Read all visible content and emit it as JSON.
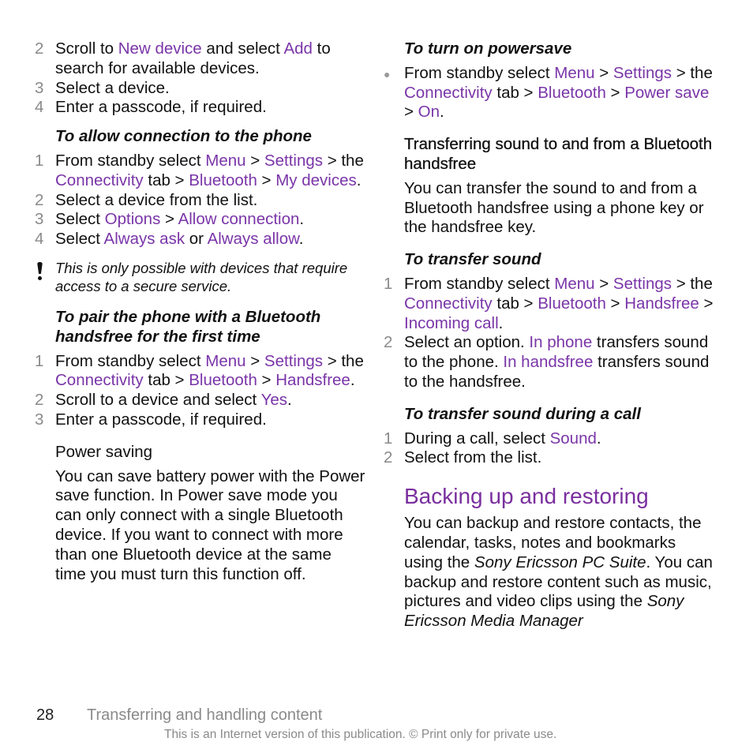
{
  "left": {
    "steps_a": [
      {
        "num": "2",
        "parts": [
          "Scroll to ",
          "New device",
          " and select ",
          "Add",
          " to search for available devices."
        ]
      },
      {
        "num": "3",
        "text": "Select a device."
      },
      {
        "num": "4",
        "text": "Enter a passcode, if required."
      }
    ],
    "allow_heading": "To allow connection to the phone",
    "allow_steps": [
      {
        "num": "1",
        "parts": [
          "From standby select ",
          "Menu",
          " > ",
          "Settings",
          " > the ",
          "Connectivity",
          " tab > ",
          "Bluetooth",
          " > ",
          "My devices",
          "."
        ]
      },
      {
        "num": "2",
        "text": "Select a device from the list."
      },
      {
        "num": "3",
        "parts": [
          "Select ",
          "Options",
          " > ",
          "Allow connection",
          "."
        ]
      },
      {
        "num": "4",
        "parts": [
          "Select ",
          "Always ask",
          " or ",
          "Always allow",
          "."
        ]
      }
    ],
    "note": "This is only possible with devices that require access to a secure service.",
    "pair_heading": "To pair the phone with a Bluetooth handsfree for the first time",
    "pair_steps": [
      {
        "num": "1",
        "parts": [
          "From standby select ",
          "Menu",
          " > ",
          "Settings",
          " > the ",
          "Connectivity",
          " tab > ",
          "Bluetooth",
          " > ",
          "Handsfree",
          "."
        ]
      },
      {
        "num": "2",
        "parts": [
          "Scroll to a device and select ",
          "Yes",
          "."
        ]
      },
      {
        "num": "3",
        "text": "Enter a passcode, if required."
      }
    ],
    "power_heading": "Power saving",
    "power_text": "You can save battery power with the Power save function. In Power save mode you can only connect with a single Bluetooth device. If you want to connect with more than one Bluetooth device at the same time you must turn this function off."
  },
  "right": {
    "powersave_heading": "To turn on powersave",
    "powersave_bullet": [
      "From standby select ",
      "Menu",
      " > ",
      "Settings",
      " > the ",
      "Connectivity",
      " tab > ",
      "Bluetooth",
      " > ",
      "Power save",
      " > ",
      "On",
      "."
    ],
    "transfer_heading": "Transferring sound to and from a Bluetooth handsfree",
    "transfer_text": "You can transfer the sound to and from a Bluetooth handsfree using a phone key or the handsfree key.",
    "transfer_sound_heading": "To transfer sound",
    "transfer_steps": [
      {
        "num": "1",
        "parts": [
          "From standby select ",
          "Menu",
          " > ",
          "Settings",
          " > the ",
          "Connectivity",
          " tab > ",
          "Bluetooth",
          " > ",
          "Handsfree",
          " > ",
          "Incoming call",
          "."
        ]
      },
      {
        "num": "2",
        "parts": [
          "Select an option. ",
          "In phone",
          " transfers sound to the phone. ",
          "In handsfree",
          " transfers sound to the handsfree."
        ]
      }
    ],
    "during_call_heading": "To transfer sound during a call",
    "during_steps": [
      {
        "num": "1",
        "parts": [
          "During a call, select ",
          "Sound",
          "."
        ]
      },
      {
        "num": "2",
        "text": "Select from the list."
      }
    ],
    "backup_title": "Backing up and restoring",
    "backup_parts": [
      "You can backup and restore contacts, the calendar, tasks, notes and bookmarks using the ",
      "Sony Ericsson PC Suite",
      ". You can backup and restore content such as music, pictures and video clips using the ",
      "Sony Ericsson Media Manager"
    ]
  },
  "footer": {
    "page_number": "28",
    "chapter": "Transferring and handling content",
    "copyright": "This is an Internet version of this publication. © Print only for private use."
  },
  "colors": {
    "link": "#7a35a8",
    "title": "#7a2f9e",
    "muted": "#8a8a8a"
  }
}
